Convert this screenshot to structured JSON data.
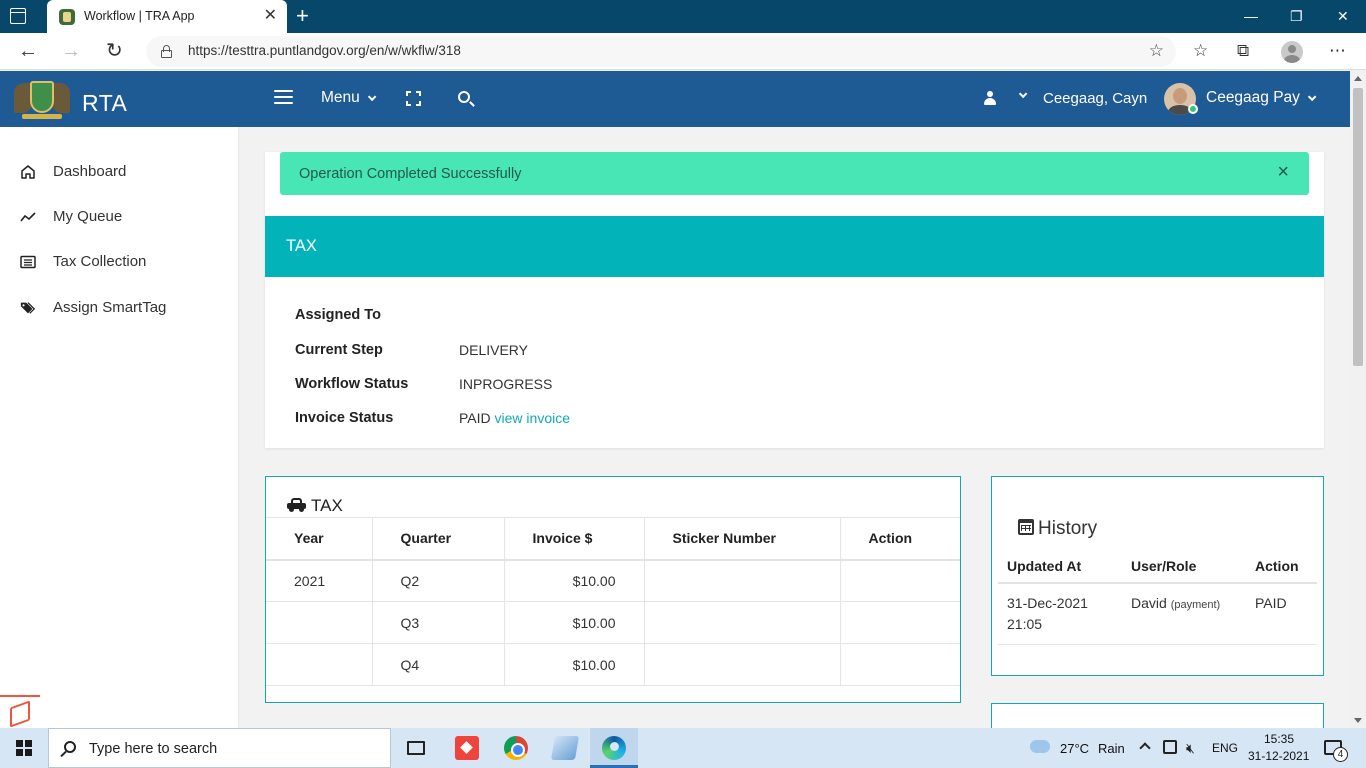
{
  "browser": {
    "tab_title": "Workflow | TRA App",
    "tab_close": "✕",
    "new_tab": "+",
    "url": "https://testtra.puntlandgov.org/en/w/wkflw/318",
    "window_minimize": "—",
    "window_restore": "❐",
    "window_close": "✕"
  },
  "header": {
    "brand": "RTA",
    "menu_label": "Menu",
    "user_name": "Ceegaag, Cayn",
    "account_name": "Ceegaag Pay",
    "brand_color": "#1e5a94"
  },
  "sidebar": {
    "items": [
      {
        "label": "Dashboard",
        "icon": "home-icon"
      },
      {
        "label": "My Queue",
        "icon": "chart-line-icon"
      },
      {
        "label": "Tax Collection",
        "icon": "list-card-icon"
      },
      {
        "label": "Assign SmartTag",
        "icon": "tags-icon"
      }
    ]
  },
  "alert": {
    "message": "Operation Completed Successfully",
    "close": "×",
    "color": "#48e6b4"
  },
  "workflow": {
    "section_title": "TAX",
    "section_color": "#02b4b9",
    "fields": [
      {
        "label": "Assigned To",
        "value": ""
      },
      {
        "label": "Current Step",
        "value": "DELIVERY"
      },
      {
        "label": "Workflow Status",
        "value": "INPROGRESS"
      },
      {
        "label": "Invoice Status",
        "value": "PAID",
        "link": "view invoice"
      }
    ]
  },
  "tax_table": {
    "title": "TAX",
    "columns": [
      "Year",
      "Quarter",
      "Invoice $",
      "Sticker Number",
      "Action"
    ],
    "rows": [
      {
        "year": "2021",
        "quarter": "Q2",
        "invoice": "$10.00",
        "sticker": "",
        "action": ""
      },
      {
        "year": "",
        "quarter": "Q3",
        "invoice": "$10.00",
        "sticker": "",
        "action": ""
      },
      {
        "year": "",
        "quarter": "Q4",
        "invoice": "$10.00",
        "sticker": "",
        "action": ""
      }
    ]
  },
  "history": {
    "title": "History",
    "columns": [
      "Updated At",
      "User/Role",
      "Action"
    ],
    "rows": [
      {
        "date": "31-Dec-2021",
        "time": "21:05",
        "user": "David",
        "role": "(payment)",
        "action": "PAID"
      }
    ]
  },
  "taskbar": {
    "search_placeholder": "Type here to search",
    "temperature": "27°C",
    "weather": "Rain",
    "language": "ENG",
    "time": "15:35",
    "date": "31-12-2021",
    "notification_count": "4"
  }
}
